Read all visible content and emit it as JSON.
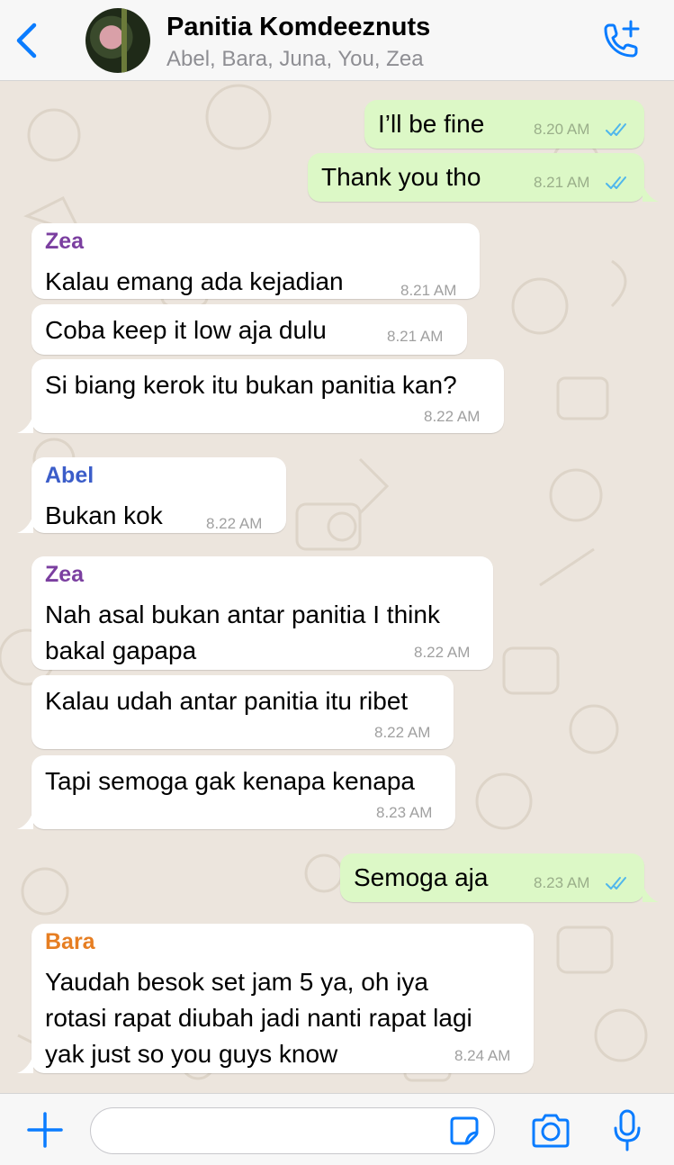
{
  "header": {
    "title": "Panitia Komdeeznuts",
    "subtitle": "Abel, Bara, Juna, You, Zea"
  },
  "colors": {
    "accent": "#0A7CFF",
    "outgoing_bubble": "#DCF8C6",
    "incoming_bubble": "#FFFFFF",
    "sender_zea": "#7B3FA0",
    "sender_abel": "#3B5DC9",
    "sender_bara": "#E67E22",
    "read_ticks": "#4FB6EC"
  },
  "messages": [
    {
      "dir": "out",
      "text": "I’ll be fine",
      "time": "8.20 AM",
      "status": "read"
    },
    {
      "dir": "out",
      "text": "Thank you tho",
      "time": "8.21 AM",
      "status": "read"
    },
    {
      "dir": "in",
      "sender": "Zea",
      "text": "Kalau emang ada kejadian",
      "time": "8.21 AM"
    },
    {
      "dir": "in",
      "text": "Coba keep it low aja dulu",
      "time": "8.21 AM"
    },
    {
      "dir": "in",
      "text": "Si biang kerok itu bukan panitia kan?",
      "time": "8.22 AM"
    },
    {
      "dir": "in",
      "sender": "Abel",
      "text": "Bukan kok",
      "time": "8.22 AM"
    },
    {
      "dir": "in",
      "sender": "Zea",
      "lines": [
        "Nah asal bukan antar panitia I think",
        "bakal gapapa"
      ],
      "time": "8.22 AM"
    },
    {
      "dir": "in",
      "text": "Kalau udah antar panitia itu ribet",
      "time": "8.22 AM"
    },
    {
      "dir": "in",
      "text": "Tapi semoga gak kenapa kenapa",
      "time": "8.23 AM"
    },
    {
      "dir": "out",
      "text": "Semoga aja",
      "time": "8.23 AM",
      "status": "read"
    },
    {
      "dir": "in",
      "sender": "Bara",
      "lines": [
        "Yaudah besok set jam 5 ya, oh iya",
        "rotasi rapat diubah jadi nanti rapat lagi",
        "yak just so you guys know"
      ],
      "time": "8.24 AM"
    }
  ],
  "icons": {
    "back": "chevron-left-icon",
    "call": "phone-plus-icon",
    "plus": "plus-icon",
    "sticker": "sticker-icon",
    "camera": "camera-icon",
    "mic": "microphone-icon"
  },
  "composer": {
    "value": "",
    "placeholder": ""
  }
}
